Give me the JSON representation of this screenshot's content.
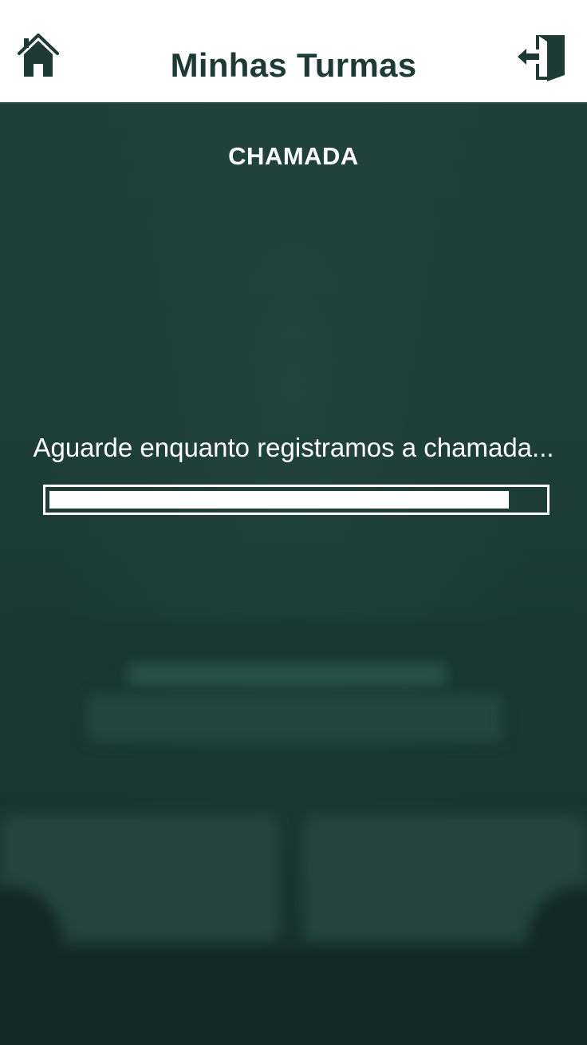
{
  "header": {
    "title": "Minhas Turmas",
    "home_icon": "home-icon",
    "exit_icon": "exit-door-icon"
  },
  "main": {
    "section_title": "CHAMADA",
    "status_text": "Aguarde enquanto registramos a chamada...",
    "progress_percent": 93
  },
  "colors": {
    "header_bg": "#ffffff",
    "brand_dark": "#1d3a33",
    "overlay": "#1c3c36",
    "text_light": "#ffffff"
  }
}
